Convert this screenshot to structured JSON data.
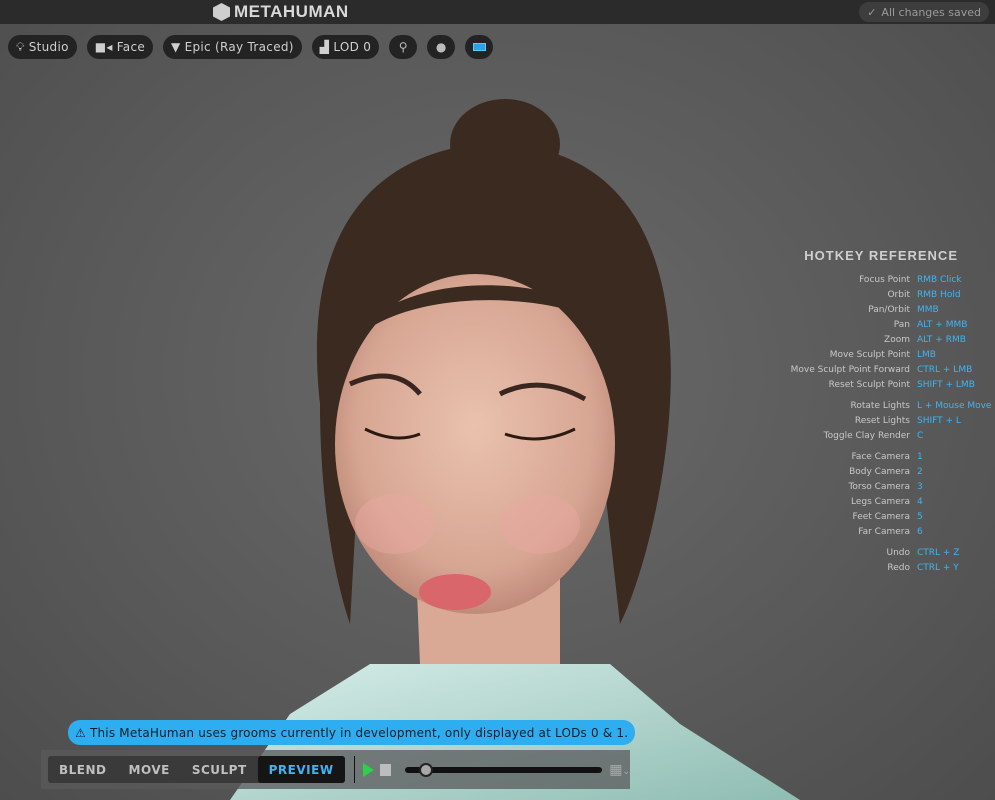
{
  "header": {
    "logo": "METAHUMAN",
    "status": "All changes saved"
  },
  "toolbar": {
    "items": [
      {
        "label": "Studio",
        "icon": "lightbulb-icon"
      },
      {
        "label": "Face",
        "icon": "camera-icon"
      },
      {
        "label": "Epic (Ray Traced)",
        "icon": "diamond-icon"
      },
      {
        "label": "LOD 0",
        "icon": "lod-icon"
      }
    ],
    "icon_buttons": [
      "dna-icon",
      "head-icon",
      "keyboard-icon"
    ]
  },
  "hotkeys": {
    "title": "HOTKEY REFERENCE",
    "groups": [
      [
        [
          "Focus Point",
          "RMB Click"
        ],
        [
          "Orbit",
          "RMB Hold"
        ],
        [
          "Pan/Orbit",
          "MMB"
        ],
        [
          "Pan",
          "ALT + MMB"
        ],
        [
          "Zoom",
          "ALT + RMB"
        ],
        [
          "Move Sculpt Point",
          "LMB"
        ],
        [
          "Move Sculpt Point Forward",
          "CTRL + LMB"
        ],
        [
          "Reset Sculpt Point",
          "SHIFT + LMB"
        ]
      ],
      [
        [
          "Rotate Lights",
          "L + Mouse Move"
        ],
        [
          "Reset Lights",
          "SHIFT + L"
        ],
        [
          "Toggle Clay Render",
          "C"
        ]
      ],
      [
        [
          "Face Camera",
          "1"
        ],
        [
          "Body Camera",
          "2"
        ],
        [
          "Torso Camera",
          "3"
        ],
        [
          "Legs Camera",
          "4"
        ],
        [
          "Feet Camera",
          "5"
        ],
        [
          "Far Camera",
          "6"
        ]
      ],
      [
        [
          "Undo",
          "CTRL + Z"
        ],
        [
          "Redo",
          "CTRL + Y"
        ]
      ]
    ]
  },
  "warning": "This MetaHuman uses grooms currently in development, only displayed at LODs 0 & 1.",
  "modes": [
    "BLEND",
    "MOVE",
    "SCULPT",
    "PREVIEW"
  ],
  "active_mode": "PREVIEW",
  "timeline_progress": 0.11
}
